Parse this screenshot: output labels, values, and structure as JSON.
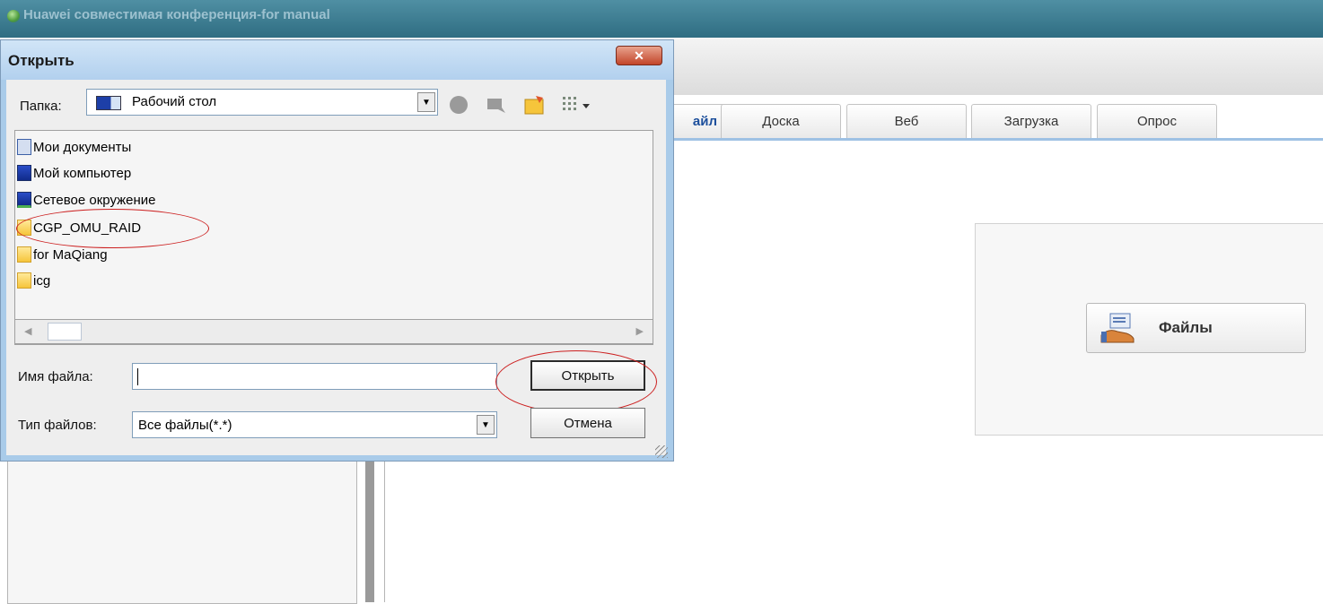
{
  "app": {
    "title": "Huawei совместимая конференция-for manual",
    "tabs": [
      {
        "label": "айл",
        "active": true
      },
      {
        "label": "Доска",
        "active": false
      },
      {
        "label": "Веб",
        "active": false
      },
      {
        "label": "Загрузка",
        "active": false
      },
      {
        "label": "Опрос",
        "active": false
      }
    ],
    "files_button": {
      "label": "Файлы",
      "icon": "files-icon"
    },
    "accent_color": "#1c4f9c"
  },
  "dialog": {
    "title": "Открыть",
    "close_icon": "close-icon",
    "folder_label": "Папка:",
    "folder_value": "Рабочий стол",
    "toolbar_icons": [
      "back-icon",
      "up-folder-icon",
      "new-folder-icon",
      "view-menu-icon"
    ],
    "items": [
      {
        "label": "Мои документы",
        "icon": "my-documents-icon"
      },
      {
        "label": "Мой компьютер",
        "icon": "my-computer-icon"
      },
      {
        "label": "Сетевое окружение",
        "icon": "network-icon"
      },
      {
        "label": "CGP_OMU_RAID",
        "icon": "folder-icon",
        "highlighted": true
      },
      {
        "label": "for MaQiang",
        "icon": "folder-icon"
      },
      {
        "label": "icg",
        "icon": "folder-icon"
      }
    ],
    "filename_label": "Имя файла:",
    "filename_value": "",
    "filetype_label": "Тип файлов:",
    "filetype_value": "Все файлы(*.*)",
    "open_button": "Открыть",
    "cancel_button": "Отмена",
    "annotation_color": "#cc1f1f"
  }
}
